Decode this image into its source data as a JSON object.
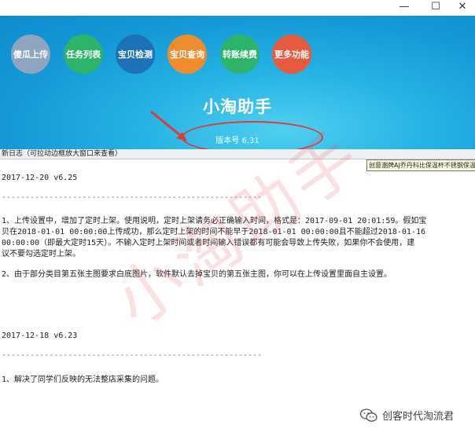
{
  "window": {
    "minimize": "—",
    "maximize": "☐",
    "close": "✕"
  },
  "toolbar": [
    {
      "label": "傻瓜上传",
      "color": "#8fa5bf"
    },
    {
      "label": "任务列表",
      "color": "#2eb36b"
    },
    {
      "label": "宝贝检测",
      "color": "#1d72b5"
    },
    {
      "label": "宝贝查询",
      "color": "#f08c2e"
    },
    {
      "label": "转账续费",
      "color": "#2eb36b"
    },
    {
      "label": "更多功能",
      "color": "#e85a3e"
    }
  ],
  "app": {
    "title": "小淘助手",
    "version": "版本号 6.31"
  },
  "log": {
    "header": "新日志（可拉动边框放大窗口来查看）",
    "tooltip": "创意潮牌AJ乔丹科比保温杯不锈钢保温...",
    "lines": [
      "2017-12-20 v6.25",
      "-------------------------------------------------------",
      "1、上传设置中，增加了定时上架。使用说明，定时上架请务必正确输入时间，格式是：2017-09-01 20:01:59。假如宝",
      "贝在2018-01-01 00:00:00上传成功，那么定时上架的时间不能早于2018-01-01 00:00:00且不能超过2018-01-16",
      "00:00:00（即最大定时15天）。不输入定时上架时间或者时间输入错误都有可能会导致上传失败，如果你不会使用，建",
      "议不要勾选定时上架。",
      "2、由于部分类目第五张主图要求白底图片，软件默认去掉宝贝的第五张主图，你可以在上传设置里面自主设置。",
      "2017-12-18 v6.23",
      "-------------------------------------------------------",
      "1、解决了同学们反映的无法整店采集的问题。"
    ]
  },
  "watermark": "小淘助手",
  "wechat": {
    "icon": "wechat-icon",
    "account": "创客时代淘流君"
  },
  "colors": {
    "header": "#1da6e0",
    "annotation": "#e03a3a"
  }
}
